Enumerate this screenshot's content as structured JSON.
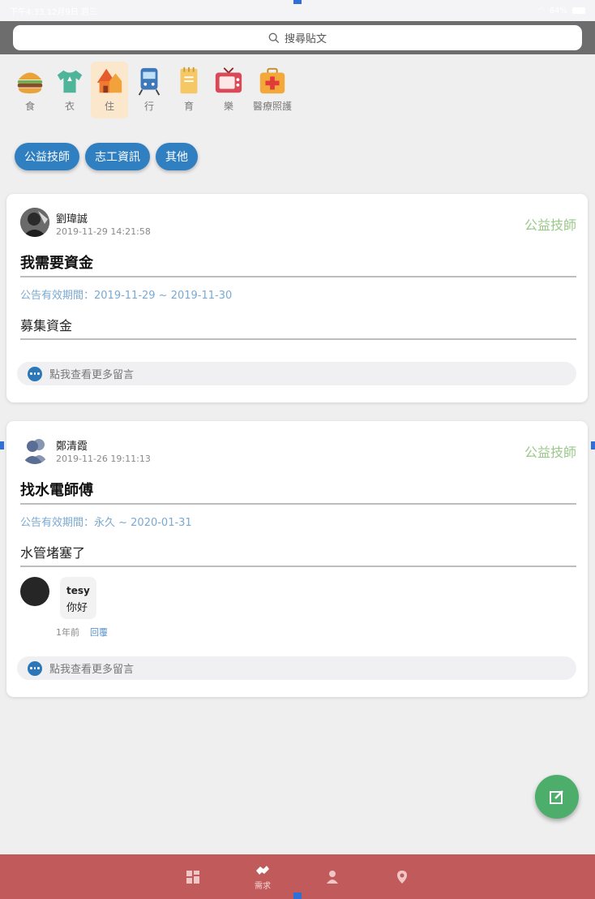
{
  "status_bar": {
    "time": "下午4:33",
    "date": "12月9日 週三",
    "battery": "84%"
  },
  "search": {
    "placeholder": "搜尋貼文"
  },
  "categories": [
    {
      "label": "食",
      "icon": "hamburger-icon"
    },
    {
      "label": "衣",
      "icon": "shirt-icon"
    },
    {
      "label": "住",
      "icon": "house-icon",
      "active": true
    },
    {
      "label": "行",
      "icon": "train-icon"
    },
    {
      "label": "育",
      "icon": "notebook-icon"
    },
    {
      "label": "樂",
      "icon": "tv-icon"
    },
    {
      "label": "醫療照護",
      "icon": "medical-kit-icon"
    }
  ],
  "chips": [
    "公益技師",
    "志工資訊",
    "其他"
  ],
  "posts": [
    {
      "author": "劉瑋誠",
      "time": "2019-11-29 14:21:58",
      "category": "公益技師",
      "title": "我需要資金",
      "validity": "公告有效期間：2019-11-29 ~ 2019-11-30",
      "body": "募集資金",
      "more": "點我查看更多留言"
    },
    {
      "author": "鄭清霞",
      "time": "2019-11-26 19:11:13",
      "category": "公益技師",
      "title": "找水電師傅",
      "validity": "公告有效期間：永久 ~ 2020-01-31",
      "body": "水管堵塞了",
      "comment": {
        "user": "tesy",
        "text": "你好",
        "ago": "1年前",
        "reply": "回覆"
      },
      "more": "點我查看更多留言"
    }
  ],
  "bottom_nav": {
    "active_label": "需求"
  },
  "colors": {
    "chip": "#2f7fc1",
    "category_tag": "#9bc98a",
    "fab": "#4dae6b",
    "nav": "#c15a5a"
  }
}
